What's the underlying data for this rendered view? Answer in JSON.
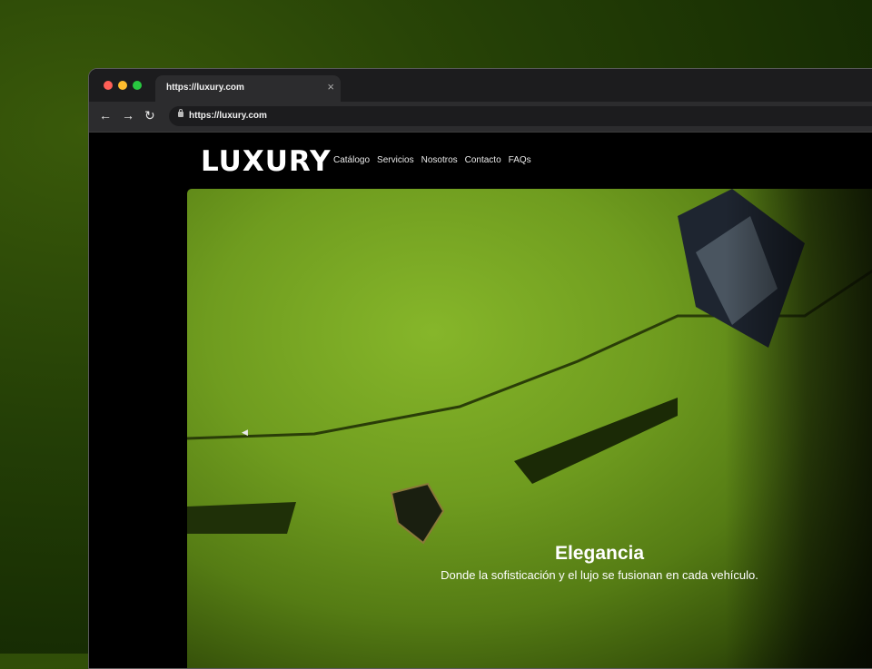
{
  "browser": {
    "tab_title": "https://luxury.com",
    "tab_close": "×",
    "address": "https://luxury.com",
    "traffic_lights": {
      "close": "#ff5f57",
      "minimize": "#febc2e",
      "maximize": "#28c840"
    },
    "nav_icons": {
      "back": "←",
      "forward": "→",
      "reload": "↻"
    }
  },
  "site": {
    "logo": "LUXURY",
    "menu": [
      "Catálogo",
      "Servicios",
      "Nosotros",
      "Contacto",
      "FAQs"
    ]
  },
  "hero": {
    "title": "Elegancia",
    "subtitle": "Donde la sofisticación y el lujo se fusionan en cada vehículo.",
    "prev_icon": "◀",
    "accent": "#7aab22"
  }
}
